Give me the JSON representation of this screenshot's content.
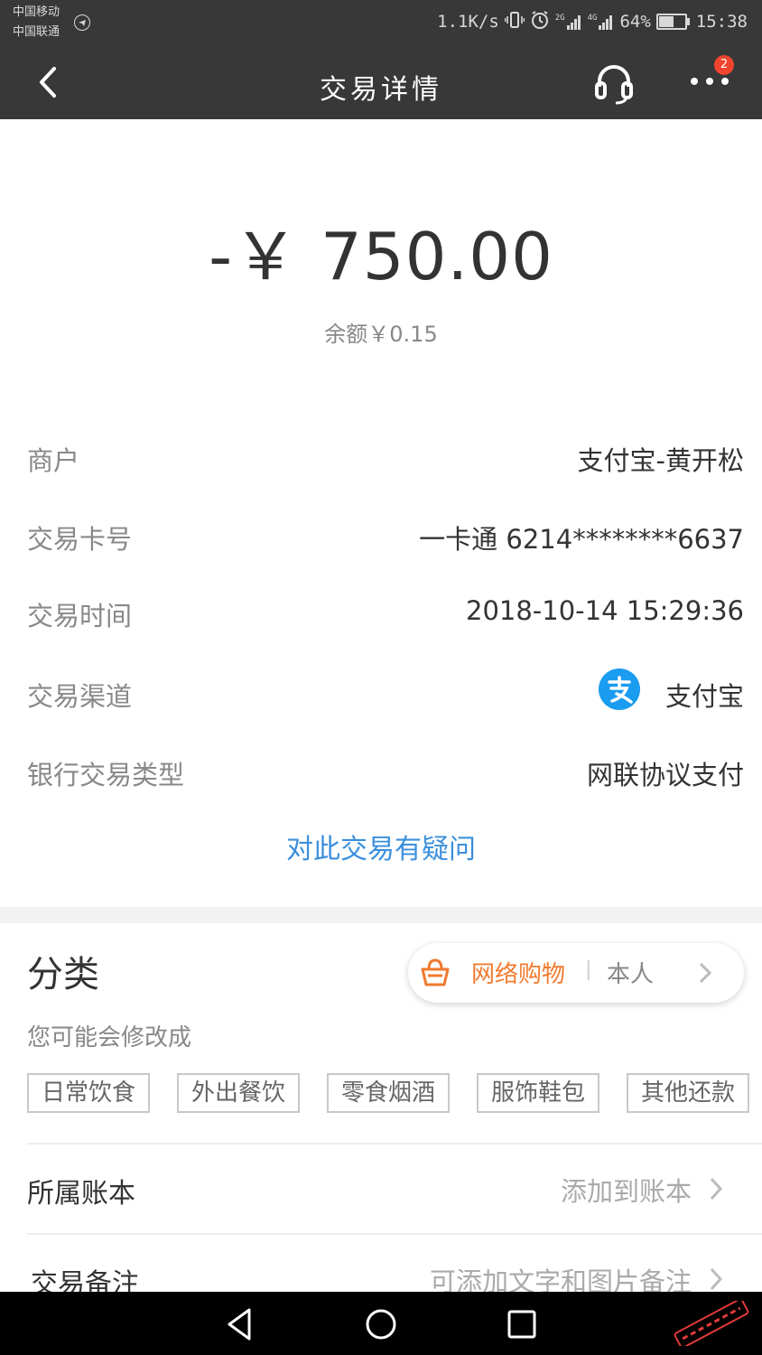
{
  "status_bar": {
    "carrier1": "中国移动",
    "carrier2": "中国联通",
    "net_speed": "1.1K/s",
    "signal1": "2G",
    "signal2": "4G",
    "battery": "64%",
    "battery_level": 0.64,
    "time": "15:38"
  },
  "nav": {
    "title": "交易详情",
    "badge_count": "2"
  },
  "summary": {
    "amount": "-￥ 750.00",
    "balance": "余额￥0.15"
  },
  "details": [
    {
      "label": "商户",
      "value": "支付宝-黄开松"
    },
    {
      "label": "交易卡号",
      "value": "一卡通 6214********6637"
    },
    {
      "label": "交易时间",
      "value": "2018-10-14 15:29:36"
    },
    {
      "label": "交易渠道",
      "value": "支付宝"
    },
    {
      "label": "银行交易类型",
      "value": "网联协议支付"
    }
  ],
  "question_link": "对此交易有疑问",
  "category": {
    "title": "分类",
    "current": "网络购物",
    "separator": "|",
    "person": "本人",
    "hint": "您可能会修改成",
    "options": [
      "日常饮食",
      "外出餐饮",
      "零食烟酒",
      "服饰鞋包",
      "其他还款"
    ]
  },
  "ledger": {
    "label": "所属账本",
    "value": "添加到账本"
  },
  "note": {
    "label": "交易备注",
    "value": "可添加文字和图片备注"
  },
  "colors": {
    "header": "#383838",
    "link": "#3b8fdc",
    "accent": "#f07a2e",
    "alipay": "#1a9cf0",
    "badge": "#f0442f"
  }
}
